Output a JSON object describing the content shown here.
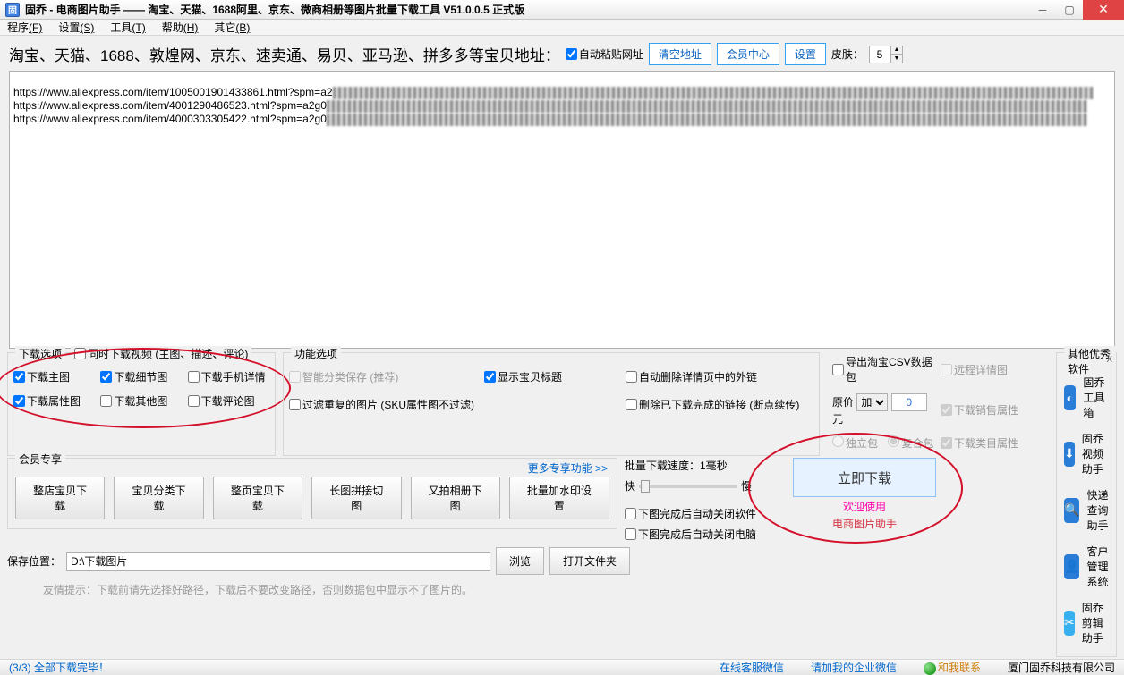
{
  "window": {
    "title": "固乔 - 电商图片助手 —— 淘宝、天猫、1688阿里、京东、微商相册等图片批量下载工具 V51.0.0.5 正式版"
  },
  "menu": {
    "program": "程序",
    "program_k": "(F)",
    "settings": "设置",
    "settings_k": "(S)",
    "tools": "工具",
    "tools_k": "(T)",
    "help": "帮助",
    "help_k": "(H)",
    "other": "其它",
    "other_k": "(B)"
  },
  "addr": {
    "label": "淘宝、天猫、1688、敦煌网、京东、速卖通、易贝、亚马逊、拼多多等宝贝地址：",
    "auto_paste": "自动粘贴网址",
    "clear": "清空地址",
    "center": "会员中心",
    "settings": "设置",
    "skin": "皮肤：",
    "skin_val": "5"
  },
  "urls": [
    "https://www.aliexpress.com/item/1005001901433861.html?spm=a2",
    "https://www.aliexpress.com/item/4001290486523.html?spm=a2g0",
    "https://www.aliexpress.com/item/4000303305422.html?spm=a2g0"
  ],
  "dl_group": {
    "title": "下载选项",
    "also_video": "同时下载视频 (主图、描述、评论)",
    "main": "下载主图",
    "detail": "下载细节图",
    "mobile": "下载手机详情",
    "attr": "下载属性图",
    "other": "下载其他图",
    "review": "下载评论图"
  },
  "fn_group": {
    "title": "功能选项",
    "smart": "智能分类保存 (推荐)",
    "show_title": "显示宝贝标题",
    "remove_ext": "自动删除详情页中的外链",
    "filter_dup": "过滤重复的图片 (SKU属性图不过滤)",
    "del_done": "删除已下载完成的链接 (断点续传)"
  },
  "csv_group": {
    "export": "导出淘宝CSV数据包",
    "remote": "远程详情图",
    "price_lbl": "原价",
    "op": "加",
    "price_val": "0",
    "yuan": "元",
    "sale_attr": "下载销售属性",
    "single": "独立包",
    "combo": "复合包",
    "cat_attr": "下载类目属性"
  },
  "member": {
    "title": "会员专享",
    "more": "更多专享功能 >>",
    "b1": "整店宝贝下载",
    "b2": "宝贝分类下载",
    "b3": "整页宝贝下载",
    "b4": "长图拼接切图",
    "b5": "又拍相册下图",
    "b6": "批量加水印设置"
  },
  "speed": {
    "label": "批量下载速度：1毫秒",
    "fast": "快",
    "slow": "慢",
    "close_app": "下图完成后自动关闭软件",
    "close_pc": "下图完成后自动关闭电脑"
  },
  "big": {
    "btn": "立即下载",
    "welcome": "欢迎使用",
    "helper": "电商图片助手"
  },
  "save": {
    "label": "保存位置：",
    "path": "D:\\下载图片",
    "browse": "浏览",
    "open": "打开文件夹",
    "hint": "友情提示：下载前请先选择好路径，下载后不要改变路径，否则数据包中显示不了图片的。"
  },
  "soft": {
    "title": "其他优秀软件",
    "items": [
      {
        "name": "固乔工具箱",
        "color": "#2a7dd6"
      },
      {
        "name": "固乔视频助手",
        "color": "#2a7dd6"
      },
      {
        "name": "快递查询助手",
        "color": "#2a7dd6"
      },
      {
        "name": "客户管理系统",
        "color": "#2a7dd6"
      },
      {
        "name": "固乔剪辑助手",
        "color": "#38b0f0"
      }
    ]
  },
  "status": {
    "progress": "(3/3) 全部下载完毕！",
    "wechat": "在线客服微信",
    "qywx": "请加我的企业微信",
    "contact": "和我联系",
    "company": "厦门固乔科技有限公司"
  }
}
